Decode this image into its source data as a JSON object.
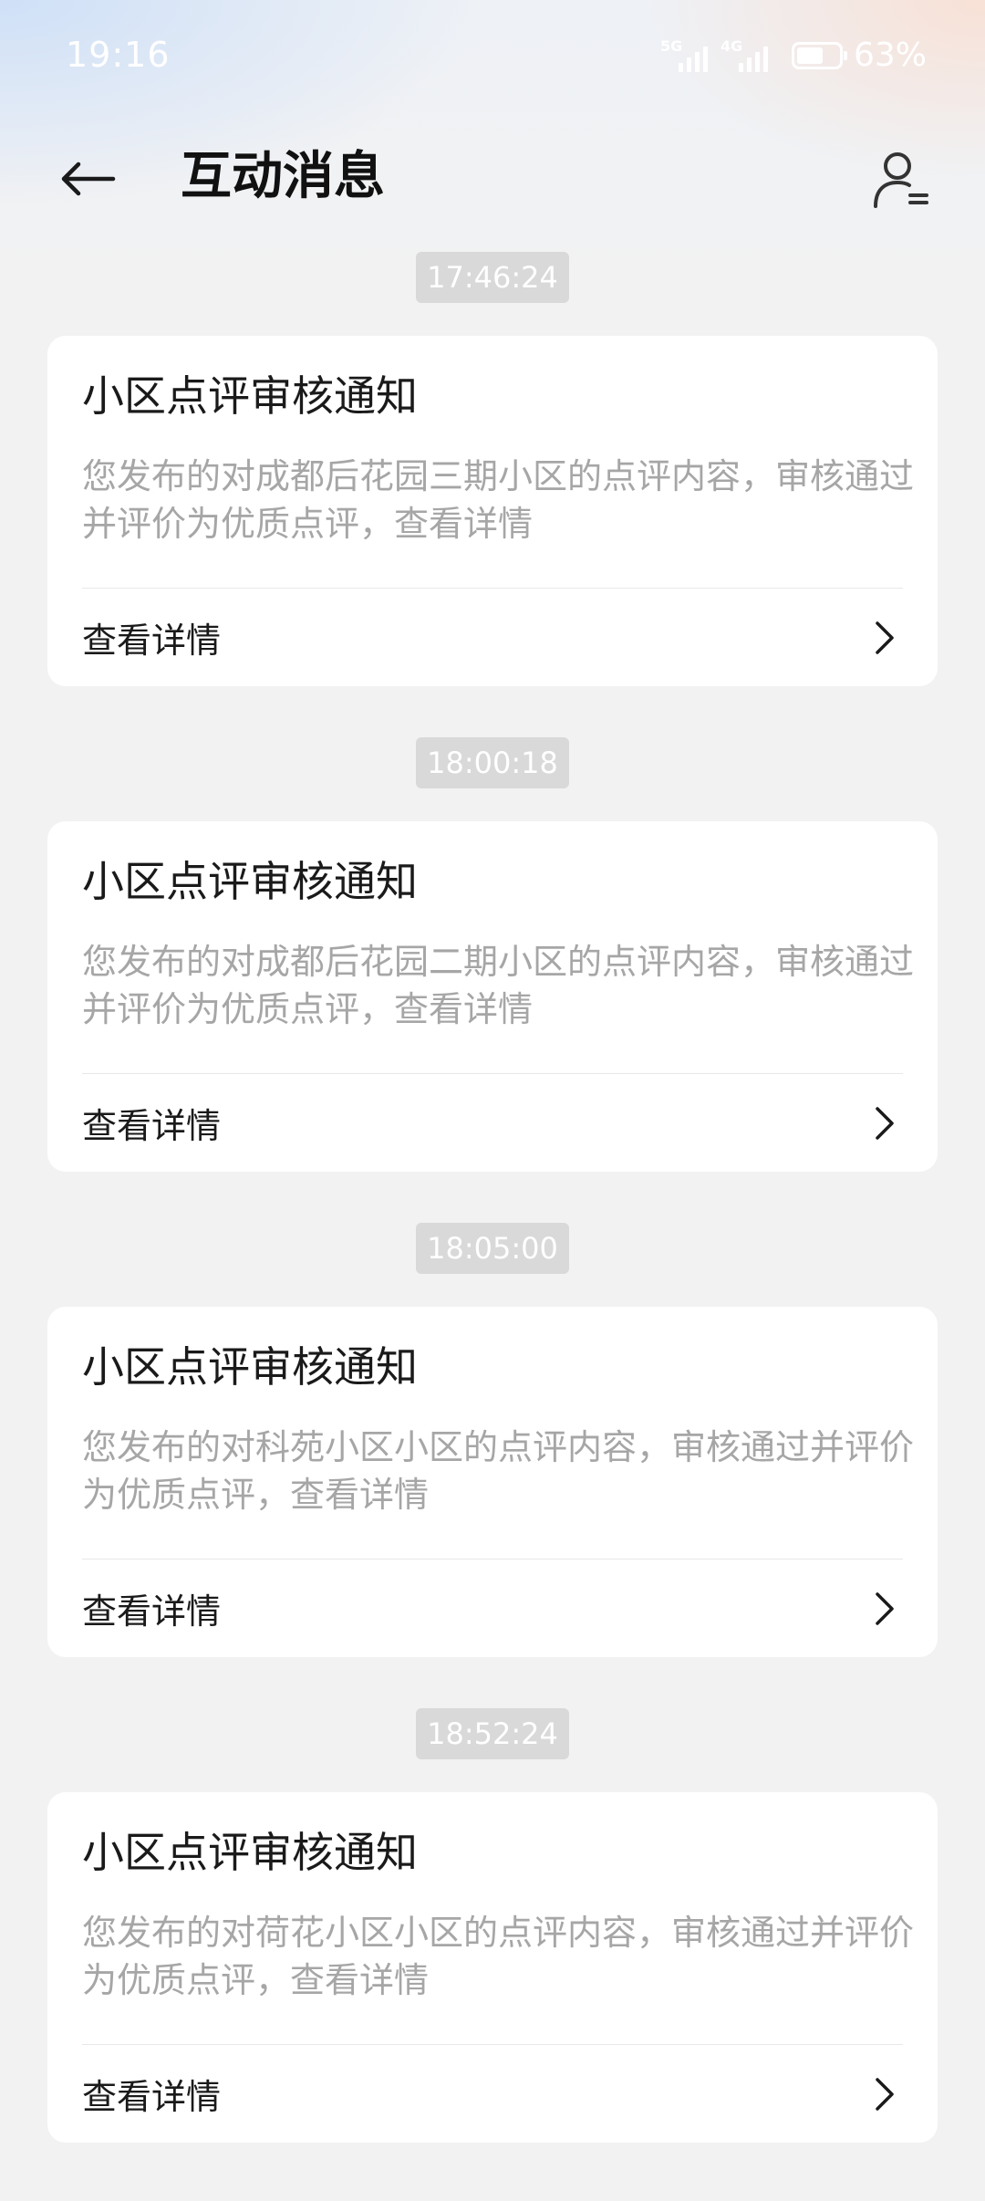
{
  "status_bar": {
    "time": "19:16",
    "signal_1_network": "5G",
    "signal_2_network": "4G",
    "battery_percent": "63%",
    "battery_level": 0.63
  },
  "header": {
    "title": "互动消息",
    "back_icon": "arrow-left-icon",
    "profile_icon": "user-settings-icon"
  },
  "messages": [
    {
      "time": "17:46:24",
      "title": "小区点评审核通知",
      "body": "您发布的对成都后花园三期小区的点评内容，审核通过并评价为优质点评，查看详情",
      "action_label": "查看详情"
    },
    {
      "time": "18:00:18",
      "title": "小区点评审核通知",
      "body": "您发布的对成都后花园二期小区的点评内容，审核通过并评价为优质点评，查看详情",
      "action_label": "查看详情"
    },
    {
      "time": "18:05:00",
      "title": "小区点评审核通知",
      "body": "您发布的对科苑小区小区的点评内容，审核通过并评价为优质点评，查看详情",
      "action_label": "查看详情"
    },
    {
      "time": "18:52:24",
      "title": "小区点评审核通知",
      "body": "您发布的对荷花小区小区的点评内容，审核通过并评价为优质点评，查看详情",
      "action_label": "查看详情"
    }
  ]
}
